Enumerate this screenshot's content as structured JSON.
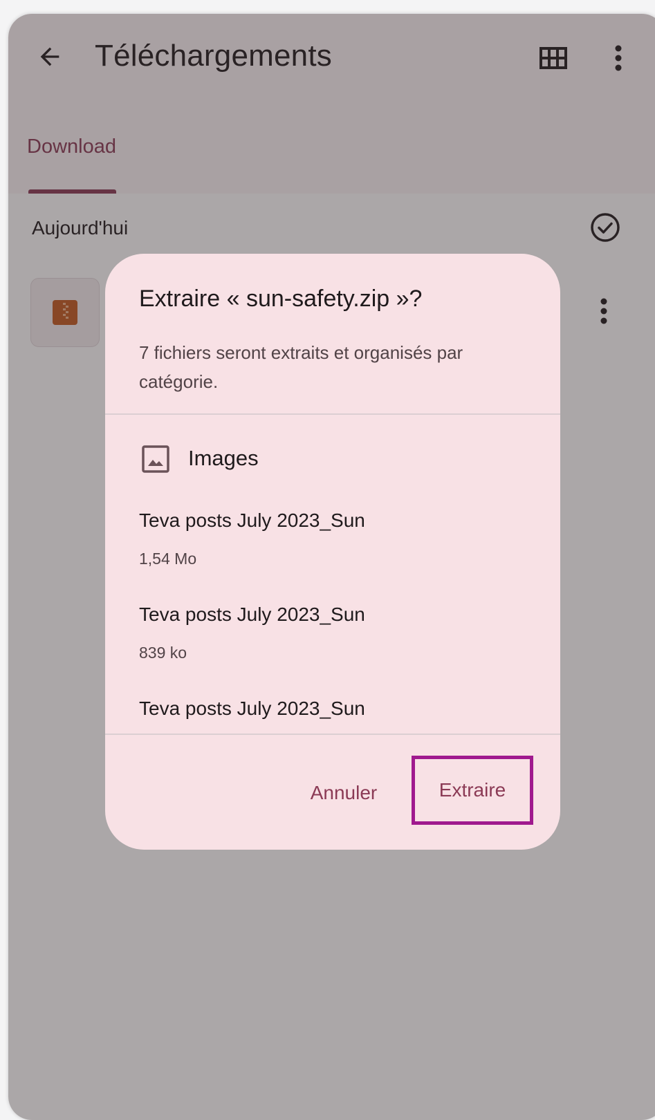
{
  "appbar": {
    "title": "Téléchargements",
    "back_icon": "arrow-back-icon",
    "grid_icon": "grid-view-icon",
    "more_icon": "more-vert-icon"
  },
  "tabs": [
    {
      "label": "Download",
      "selected": true
    }
  ],
  "list": {
    "section_label": "Aujourd'hui",
    "select_icon": "check-circle-icon",
    "file_icon": "zip-file-icon"
  },
  "dialog": {
    "title": "Extraire « sun-safety.zip »?",
    "description": "7 fichiers seront extraits et organisés par catégorie.",
    "category": {
      "label": "Images",
      "icon": "image-icon"
    },
    "files": [
      {
        "name": "Teva posts July 2023_Sun",
        "size": "1,54 Mo"
      },
      {
        "name": "Teva posts July 2023_Sun",
        "size": "839 ko"
      },
      {
        "name": "Teva posts July 2023_Sun",
        "size": ""
      }
    ],
    "cancel_label": "Annuler",
    "extract_label": "Extraire"
  },
  "colors": {
    "accent": "#8b3a55",
    "highlight": "#a0198e",
    "dialog_bg": "#f8e1e5",
    "zip_icon": "#c35b1f"
  }
}
